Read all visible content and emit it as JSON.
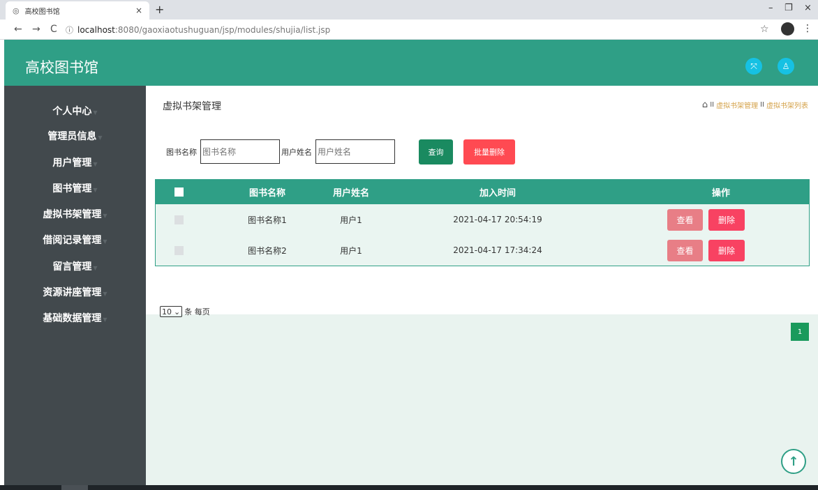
{
  "browser": {
    "tab_title": "高校图书馆",
    "tab_favicon": "◎",
    "tab_close": "×",
    "new_tab": "+",
    "win_min": "–",
    "win_restore": "❐",
    "win_close": "×",
    "back": "←",
    "forward": "→",
    "reload": "C",
    "info": "ⓘ",
    "url_host": "localhost",
    "url_path": ":8080/gaoxiaotushuguan/jsp/modules/shujia/list.jsp",
    "star": "☆",
    "menu": "⋮"
  },
  "header": {
    "brand": "高校图书馆",
    "fullscreen_icon": "⤧",
    "user_icon": "♙"
  },
  "sidebar": {
    "items": [
      {
        "label": "个人中心"
      },
      {
        "label": "管理员信息"
      },
      {
        "label": "用户管理"
      },
      {
        "label": "图书管理"
      },
      {
        "label": "虚拟书架管理"
      },
      {
        "label": "借阅记录管理"
      },
      {
        "label": "留言管理"
      },
      {
        "label": "资源讲座管理"
      },
      {
        "label": "基础数据管理"
      }
    ],
    "arrow": "▼"
  },
  "content": {
    "title": "虚拟书架管理",
    "breadcrumb": {
      "home_icon": "⌂",
      "sep": "II",
      "items": [
        "虚拟书架管理",
        "虚拟书架列表"
      ]
    },
    "search": {
      "book_label": "图书名称",
      "book_placeholder": "图书名称",
      "user_label": "用户姓名",
      "user_placeholder": "用户姓名",
      "query_btn": "查询",
      "batch_delete_btn": "批量删除"
    },
    "table": {
      "headers": [
        "图书名称",
        "用户姓名",
        "加入时间",
        "操作"
      ],
      "rows": [
        {
          "book": "图书名称1",
          "user": "用户1",
          "time": "2021-04-17 20:54:19"
        },
        {
          "book": "图书名称2",
          "user": "用户1",
          "time": "2021-04-17 17:34:24"
        }
      ],
      "view_btn": "查看",
      "delete_btn": "删除"
    },
    "pagination": {
      "page_size": "10",
      "page_size_arrow": "⌄",
      "per_page_label": "条 每页",
      "current_page": "1"
    }
  },
  "scroll_top_icon": "↑",
  "colors": {
    "header": "#2f9f86",
    "sidebar": "#42494d",
    "query": "#1a8a60",
    "danger": "#ff4a52"
  }
}
